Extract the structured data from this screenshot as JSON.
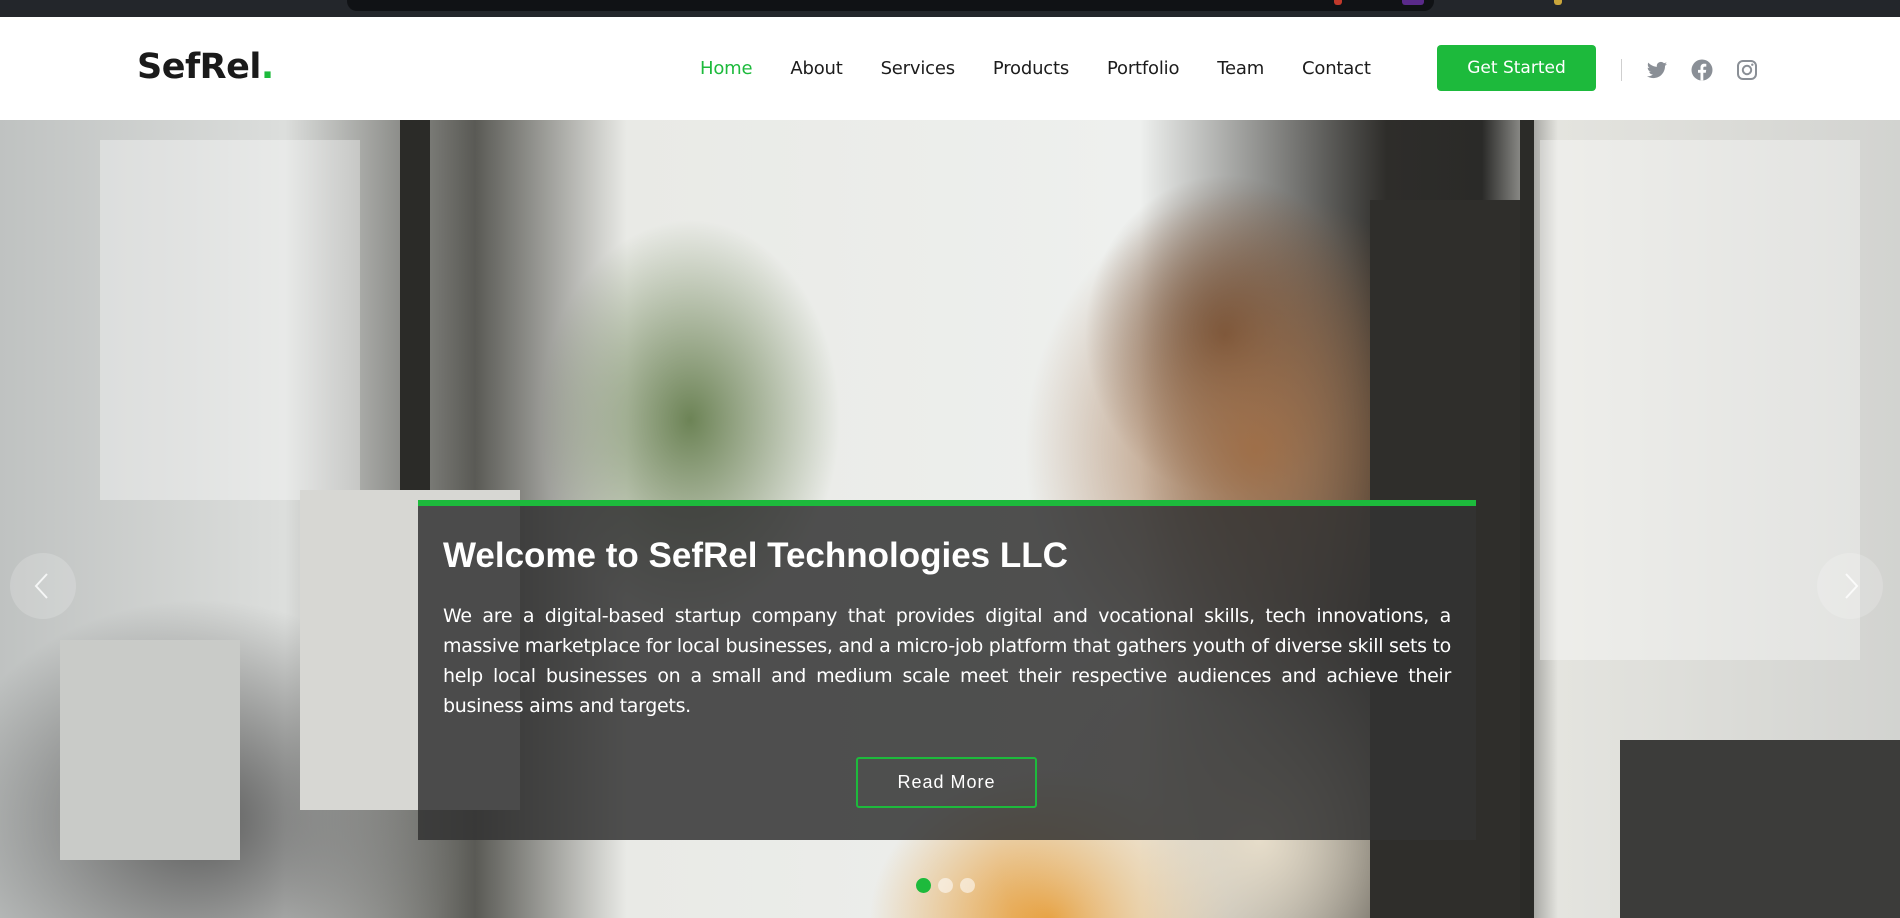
{
  "brand": {
    "name": "SefRel",
    "dot": ".",
    "accent_color": "#1dba3c"
  },
  "nav": {
    "items": [
      {
        "label": "Home",
        "active": true
      },
      {
        "label": "About"
      },
      {
        "label": "Services"
      },
      {
        "label": "Products"
      },
      {
        "label": "Portfolio"
      },
      {
        "label": "Team"
      },
      {
        "label": "Contact"
      }
    ],
    "cta_label": "Get Started"
  },
  "social": [
    "twitter-icon",
    "facebook-icon",
    "instagram-icon"
  ],
  "hero": {
    "title": "Welcome to SefRel Technologies LLC",
    "text": "We are a digital-based startup company that provides digital and vocational skills, tech innovations, a massive marketplace for local businesses, and a micro-job platform that gathers youth of diverse skill sets to help local businesses on a small and medium scale meet their respective audiences and achieve their business aims and targets.",
    "button_label": "Read More",
    "slides": 3,
    "active_slide": 1
  },
  "carousel": {
    "prev_icon": "chevron-left-icon",
    "next_icon": "chevron-right-icon"
  }
}
